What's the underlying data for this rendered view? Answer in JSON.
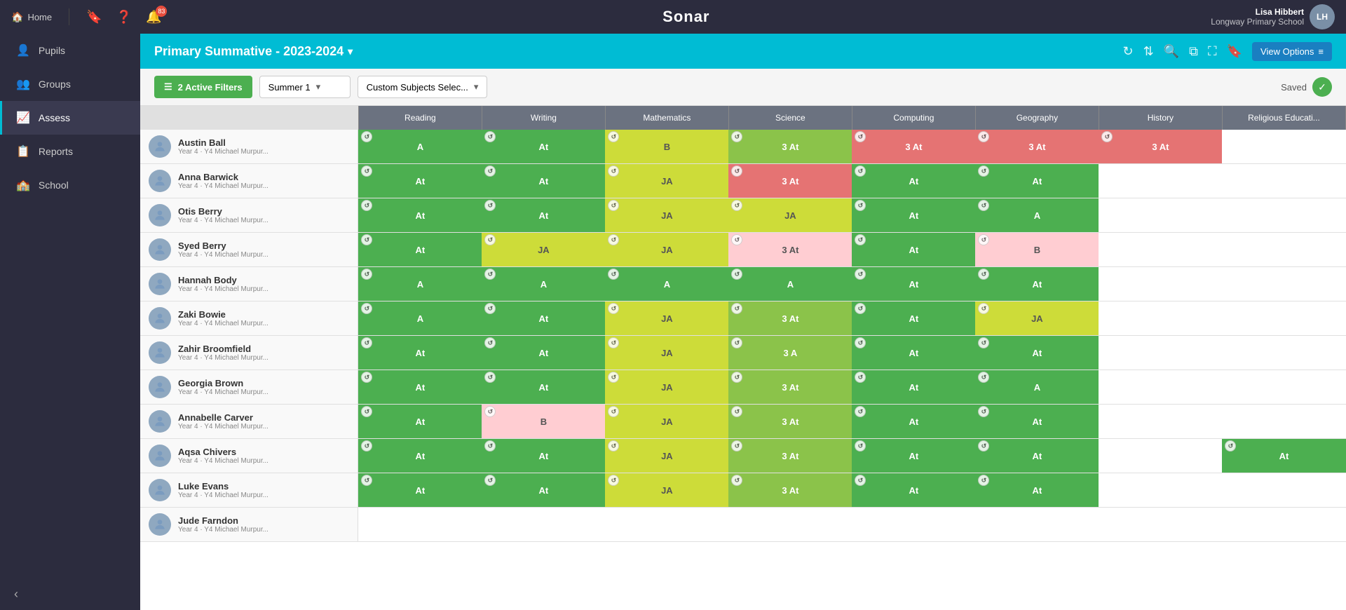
{
  "app": {
    "title": "Sonar",
    "header_title": "Primary Summative - 2023-2024"
  },
  "top_nav": {
    "home_label": "Home",
    "notification_count": "83",
    "user_name": "Lisa Hibbert",
    "user_school": "Longway Primary School"
  },
  "sidebar": {
    "items": [
      {
        "id": "home",
        "label": "Home",
        "icon": "🏠"
      },
      {
        "id": "pupils",
        "label": "Pupils",
        "icon": "👤"
      },
      {
        "id": "groups",
        "label": "Groups",
        "icon": "👥"
      },
      {
        "id": "assess",
        "label": "Assess",
        "icon": "📈",
        "active": true
      },
      {
        "id": "reports",
        "label": "Reports",
        "icon": "📋"
      },
      {
        "id": "school",
        "label": "School",
        "icon": "🏫"
      }
    ]
  },
  "filters": {
    "active_count": "2 Active Filters",
    "term": "Summer 1",
    "subject": "Custom Subjects Selec...",
    "saved_label": "Saved"
  },
  "columns": [
    "Reading",
    "Writing",
    "Mathematics",
    "Science",
    "Computing",
    "Geography",
    "History",
    "Religious Educati..."
  ],
  "students": [
    {
      "name": "Austin Ball",
      "detail": "Year 4 · Y4 Michael Murpur...",
      "grades": [
        {
          "value": "A",
          "color": "green"
        },
        {
          "value": "At",
          "color": "green"
        },
        {
          "value": "B",
          "color": "yellow"
        },
        {
          "value": "3 At",
          "color": "light-green"
        },
        {
          "value": "3 At",
          "color": "dark-red"
        },
        {
          "value": "3 At",
          "color": "dark-red"
        },
        {
          "value": "3 At",
          "color": "dark-red"
        },
        {
          "value": "",
          "color": "empty"
        }
      ]
    },
    {
      "name": "Anna Barwick",
      "detail": "Year 4 · Y4 Michael Murpur...",
      "grades": [
        {
          "value": "At",
          "color": "green"
        },
        {
          "value": "At",
          "color": "green"
        },
        {
          "value": "JA",
          "color": "yellow"
        },
        {
          "value": "3 At",
          "color": "dark-red"
        },
        {
          "value": "At",
          "color": "green"
        },
        {
          "value": "At",
          "color": "green"
        },
        {
          "value": "",
          "color": "empty"
        },
        {
          "value": "",
          "color": "empty"
        }
      ]
    },
    {
      "name": "Otis Berry",
      "detail": "Year 4 · Y4 Michael Murpur...",
      "grades": [
        {
          "value": "At",
          "color": "green"
        },
        {
          "value": "At",
          "color": "green"
        },
        {
          "value": "JA",
          "color": "yellow"
        },
        {
          "value": "JA",
          "color": "yellow"
        },
        {
          "value": "At",
          "color": "green"
        },
        {
          "value": "A",
          "color": "green"
        },
        {
          "value": "",
          "color": "empty"
        },
        {
          "value": "",
          "color": "empty"
        }
      ]
    },
    {
      "name": "Syed Berry",
      "detail": "Year 4 · Y4 Michael Murpur...",
      "grades": [
        {
          "value": "At",
          "color": "green"
        },
        {
          "value": "JA",
          "color": "yellow"
        },
        {
          "value": "JA",
          "color": "yellow"
        },
        {
          "value": "3 At",
          "color": "light-red"
        },
        {
          "value": "At",
          "color": "green"
        },
        {
          "value": "B",
          "color": "light-red"
        },
        {
          "value": "",
          "color": "empty"
        },
        {
          "value": "",
          "color": "empty"
        }
      ]
    },
    {
      "name": "Hannah Body",
      "detail": "Year 4 · Y4 Michael Murpur...",
      "grades": [
        {
          "value": "A",
          "color": "green"
        },
        {
          "value": "A",
          "color": "green"
        },
        {
          "value": "A",
          "color": "green"
        },
        {
          "value": "A",
          "color": "green"
        },
        {
          "value": "At",
          "color": "green"
        },
        {
          "value": "At",
          "color": "green"
        },
        {
          "value": "",
          "color": "empty"
        },
        {
          "value": "",
          "color": "empty"
        }
      ]
    },
    {
      "name": "Zaki Bowie",
      "detail": "Year 4 · Y4 Michael Murpur...",
      "grades": [
        {
          "value": "A",
          "color": "green"
        },
        {
          "value": "At",
          "color": "green"
        },
        {
          "value": "JA",
          "color": "yellow"
        },
        {
          "value": "3 At",
          "color": "light-green"
        },
        {
          "value": "At",
          "color": "green"
        },
        {
          "value": "JA",
          "color": "yellow"
        },
        {
          "value": "",
          "color": "empty"
        },
        {
          "value": "",
          "color": "empty"
        }
      ]
    },
    {
      "name": "Zahir Broomfield",
      "detail": "Year 4 · Y4 Michael Murpur...",
      "grades": [
        {
          "value": "At",
          "color": "green"
        },
        {
          "value": "At",
          "color": "green"
        },
        {
          "value": "JA",
          "color": "yellow"
        },
        {
          "value": "3 A",
          "color": "light-green"
        },
        {
          "value": "At",
          "color": "green"
        },
        {
          "value": "At",
          "color": "green"
        },
        {
          "value": "",
          "color": "empty"
        },
        {
          "value": "",
          "color": "empty"
        }
      ]
    },
    {
      "name": "Georgia Brown",
      "detail": "Year 4 · Y4 Michael Murpur...",
      "grades": [
        {
          "value": "At",
          "color": "green"
        },
        {
          "value": "At",
          "color": "green"
        },
        {
          "value": "JA",
          "color": "yellow"
        },
        {
          "value": "3 At",
          "color": "light-green"
        },
        {
          "value": "At",
          "color": "green"
        },
        {
          "value": "A",
          "color": "green"
        },
        {
          "value": "",
          "color": "empty"
        },
        {
          "value": "",
          "color": "empty"
        }
      ]
    },
    {
      "name": "Annabelle Carver",
      "detail": "Year 4 · Y4 Michael Murpur...",
      "grades": [
        {
          "value": "At",
          "color": "green"
        },
        {
          "value": "B",
          "color": "light-red"
        },
        {
          "value": "JA",
          "color": "yellow"
        },
        {
          "value": "3 At",
          "color": "light-green"
        },
        {
          "value": "At",
          "color": "green"
        },
        {
          "value": "At",
          "color": "green"
        },
        {
          "value": "",
          "color": "empty"
        },
        {
          "value": "",
          "color": "empty"
        }
      ]
    },
    {
      "name": "Aqsa Chivers",
      "detail": "Year 4 · Y4 Michael Murpur...",
      "grades": [
        {
          "value": "At",
          "color": "green"
        },
        {
          "value": "At",
          "color": "green"
        },
        {
          "value": "JA",
          "color": "yellow"
        },
        {
          "value": "3 At",
          "color": "light-green"
        },
        {
          "value": "At",
          "color": "green"
        },
        {
          "value": "At",
          "color": "green"
        },
        {
          "value": "",
          "color": "empty"
        },
        {
          "value": "At",
          "color": "green"
        }
      ]
    },
    {
      "name": "Luke Evans",
      "detail": "Year 4 · Y4 Michael Murpur...",
      "grades": [
        {
          "value": "At",
          "color": "green"
        },
        {
          "value": "At",
          "color": "green"
        },
        {
          "value": "JA",
          "color": "yellow"
        },
        {
          "value": "3 At",
          "color": "light-green"
        },
        {
          "value": "At",
          "color": "green"
        },
        {
          "value": "At",
          "color": "green"
        },
        {
          "value": "",
          "color": "empty"
        },
        {
          "value": "",
          "color": "empty"
        }
      ]
    },
    {
      "name": "Jude Farndon",
      "detail": "Year 4 · Y4 Michael Murpur...",
      "grades": [
        {
          "value": "",
          "color": "empty"
        },
        {
          "value": "",
          "color": "empty"
        },
        {
          "value": "",
          "color": "empty"
        },
        {
          "value": "",
          "color": "empty"
        },
        {
          "value": "",
          "color": "empty"
        },
        {
          "value": "",
          "color": "empty"
        },
        {
          "value": "",
          "color": "empty"
        },
        {
          "value": "",
          "color": "empty"
        }
      ]
    }
  ],
  "view_options_label": "View Options"
}
